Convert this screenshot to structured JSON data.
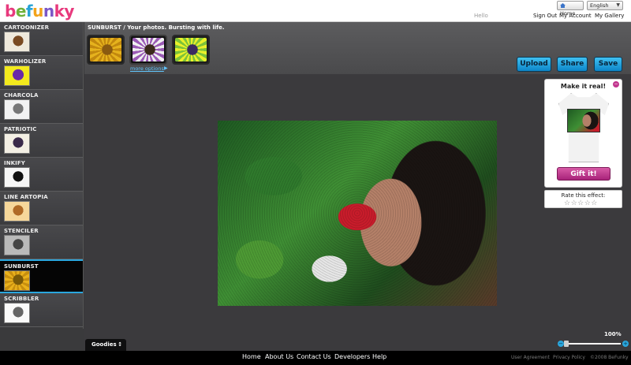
{
  "header": {
    "logo": [
      "b",
      "e",
      "f",
      "u",
      "n",
      "ky"
    ],
    "home_label": "Home",
    "language": "English",
    "greeting": "Hello",
    "links": [
      "Sign Out",
      "My Account",
      "My Gallery"
    ]
  },
  "sidebar": {
    "effects": [
      {
        "label": "CARTOONIZER"
      },
      {
        "label": "WARHOLIZER"
      },
      {
        "label": "CHARCOLA"
      },
      {
        "label": "PATRIOTIC"
      },
      {
        "label": "INKIFY"
      },
      {
        "label": "LINE ARTOPIA"
      },
      {
        "label": "STENCILER"
      },
      {
        "label": "SUNBURST",
        "active": true
      },
      {
        "label": "SCRIBBLER"
      }
    ]
  },
  "effect_header": {
    "title": "SUNBURST / Your photos. Bursting with life.",
    "more_options": "more options",
    "selected_option_index": 1
  },
  "actions": {
    "upload": "Upload",
    "share": "Share",
    "save": "Save"
  },
  "tee_panel": {
    "title": "Make it real!",
    "gift_label": "Gift it!"
  },
  "rating": {
    "label": "Rate this effect:",
    "stars": "☆☆☆☆☆"
  },
  "zoom": {
    "label": "100%",
    "minus": "−",
    "plus": "+"
  },
  "goodies": {
    "label": "Goodies"
  },
  "footer": {
    "links": [
      "Home",
      "About Us",
      "Contact Us",
      "Developers",
      "Help"
    ],
    "small_links": [
      "User Agreement",
      "Privacy Policy"
    ],
    "copyright": "©2008 BeFunky"
  },
  "colors": {
    "accent": "#2aa7de",
    "gift": "#c2388f"
  }
}
